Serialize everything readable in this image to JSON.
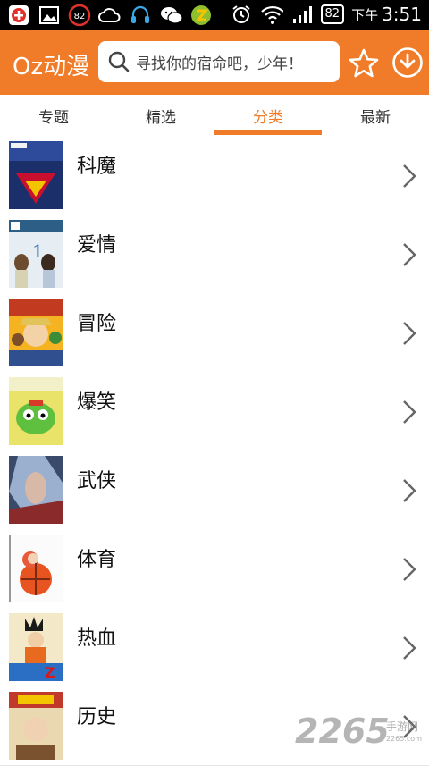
{
  "status_bar": {
    "notification_badge": "82",
    "battery": "82",
    "ampm": "下午",
    "time": "3:51"
  },
  "app_bar": {
    "logo": "Oz动漫",
    "search_placeholder": "寻找你的宿命吧，少年！",
    "accent_color": "#f07c2a"
  },
  "tabs": [
    {
      "label": "专题"
    },
    {
      "label": "精选"
    },
    {
      "label": "分类",
      "active": true
    },
    {
      "label": "最新"
    }
  ],
  "categories": [
    {
      "label": "科魔",
      "thumb_icon": "superman-cover"
    },
    {
      "label": "爱情",
      "thumb_icon": "romance-cover"
    },
    {
      "label": "冒险",
      "thumb_icon": "onepiece-cover"
    },
    {
      "label": "爆笑",
      "thumb_icon": "keroro-cover"
    },
    {
      "label": "武侠",
      "thumb_icon": "martial-cover"
    },
    {
      "label": "体育",
      "thumb_icon": "sports-cover"
    },
    {
      "label": "热血",
      "thumb_icon": "dragonball-cover"
    },
    {
      "label": "历史",
      "thumb_icon": "history-cover"
    }
  ],
  "watermark": {
    "brand": "2265",
    "sub": "手游网",
    "url": "2265.com"
  }
}
